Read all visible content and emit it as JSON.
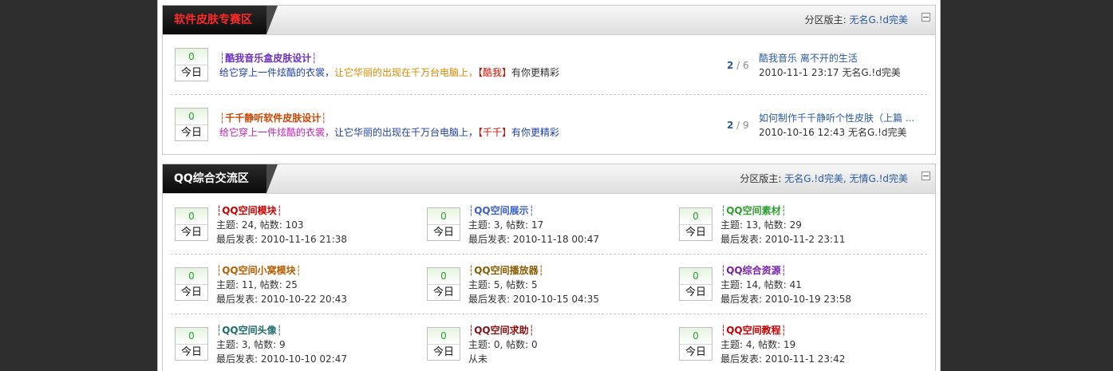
{
  "sections": [
    {
      "title": "软件皮肤专赛区",
      "title_color": "#ff2a2a",
      "moderator_label": "分区版主: ",
      "moderators": "无名G.!d完美",
      "forums": [
        {
          "badge_count": "0",
          "badge_label": "今日",
          "title": "┆酷我音乐盒皮肤设计┆",
          "title_color": "#6b2fbf",
          "desc": [
            {
              "text": "给它穿上一件炫酷的衣裳，",
              "color": "#1f3ea8"
            },
            {
              "text": "让它华丽的出现在千万台电脑上，",
              "color": "#d98a00"
            },
            {
              "text": "【酷我】",
              "color": "#cc1100"
            },
            {
              "text": "有你更精彩",
              "color": "#333333"
            }
          ],
          "threads": "2",
          "posts": "6",
          "last_title": "酷我音乐 离不开的生活",
          "last_meta": "2010-11-1 23:17 无名G.!d完美"
        },
        {
          "badge_count": "0",
          "badge_label": "今日",
          "title": "┆千千静听软件皮肤设计┆",
          "title_color": "#cc4400",
          "desc": [
            {
              "text": "给它穿上一件炫酷的衣裳，",
              "color": "#c21fb0"
            },
            {
              "text": "让它华丽的出现在千万台电脑上，",
              "color": "#1f3ea8"
            },
            {
              "text": "【千千】",
              "color": "#cc1100"
            },
            {
              "text": "有你更精彩",
              "color": "#1f3ea8"
            }
          ],
          "threads": "2",
          "posts": "9",
          "last_title": "如何制作千千静听个性皮肤（上篇 ...",
          "last_meta": "2010-10-16 12:43 无名G.!d完美"
        }
      ]
    },
    {
      "title": "QQ综合交流区",
      "title_color": "#ffffff",
      "moderator_label": "分区版主: ",
      "moderators": "无名G.!d完美, 无情G.!d完美",
      "grid": [
        {
          "title": "┆QQ空间模块┆",
          "color": "#cc0000",
          "stats": "主题: 24, 帖数: 103",
          "last": "最后发表: 2010-11-16 21:38",
          "badge_count": "0",
          "badge_label": "今日"
        },
        {
          "title": "┆QQ空间展示┆",
          "color": "#3a5fcd",
          "stats": "主题: 3, 帖数: 17",
          "last": "最后发表: 2010-11-18 00:47",
          "badge_count": "0",
          "badge_label": "今日"
        },
        {
          "title": "┆QQ空间素材┆",
          "color": "#2e9e2e",
          "stats": "主题: 13, 帖数: 29",
          "last": "最后发表: 2010-11-2 23:11",
          "badge_count": "0",
          "badge_label": "今日"
        },
        {
          "title": "┆QQ空间小窝模块┆",
          "color": "#b85c00",
          "stats": "主题: 11, 帖数: 25",
          "last": "最后发表: 2010-10-22 20:43",
          "badge_count": "0",
          "badge_label": "今日"
        },
        {
          "title": "┆QQ空间播放器┆",
          "color": "#8a5a00",
          "stats": "主题: 5, 帖数: 5",
          "last": "最后发表: 2010-10-15 04:35",
          "badge_count": "0",
          "badge_label": "今日"
        },
        {
          "title": "┆QQ综合资源┆",
          "color": "#7a1fa8",
          "stats": "主题: 14, 帖数: 41",
          "last": "最后发表: 2010-10-19 23:58",
          "badge_count": "0",
          "badge_label": "今日"
        },
        {
          "title": "┆QQ空间头像┆",
          "color": "#1f6a6a",
          "stats": "主题: 3, 帖数: 9",
          "last": "最后发表: 2010-10-10 02:47",
          "badge_count": "0",
          "badge_label": "今日"
        },
        {
          "title": "┆QQ空间求助┆",
          "color": "#8a1010",
          "stats": "主题: 0, 帖数: 0",
          "last": "从未",
          "badge_count": "0",
          "badge_label": "今日"
        },
        {
          "title": "┆QQ空间教程┆",
          "color": "#cc0000",
          "stats": "主题: 4, 帖数: 19",
          "last": "最后发表: 2010-11-1 23:42",
          "badge_count": "0",
          "badge_label": "今日"
        }
      ]
    }
  ]
}
